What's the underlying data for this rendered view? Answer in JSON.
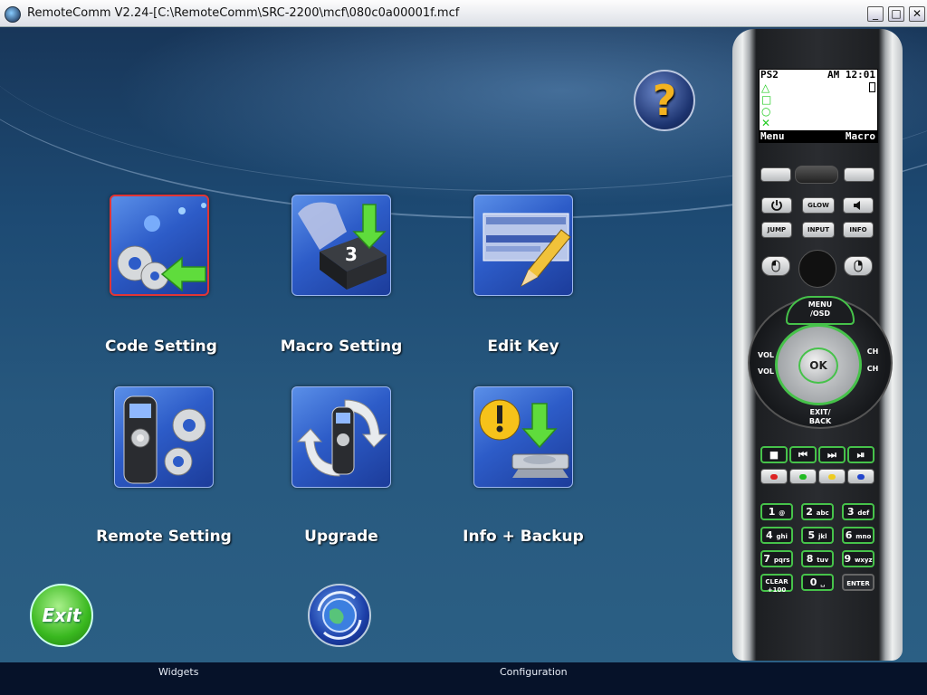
{
  "window": {
    "title": "RemoteComm V2.24-[C:\\RemoteComm\\SRC-2200\\mcf\\080c0a00001f.mcf",
    "minimize": "_",
    "maximize": "□",
    "close": "✕"
  },
  "main": {
    "help_symbol": "?",
    "tiles": [
      {
        "label": "Code Setting",
        "selected": true
      },
      {
        "label": "Macro Setting",
        "selected": false
      },
      {
        "label": "Edit Key",
        "selected": false
      },
      {
        "label": "Remote Setting",
        "selected": false
      },
      {
        "label": "Upgrade",
        "selected": false
      },
      {
        "label": "Info + Backup",
        "selected": false
      }
    ],
    "exit_label": "Exit"
  },
  "bottom_tabs": [
    "Widgets",
    "Configuration"
  ],
  "remote": {
    "lcd": {
      "device": "PS2",
      "time": "AM 12:01",
      "symbols": [
        "△",
        "□",
        "○",
        "✕"
      ],
      "soft_left": "Menu",
      "soft_right": "Macro"
    },
    "top_buttons": [
      "GLOW",
      "JUMP",
      "INPUT",
      "INFO"
    ],
    "nav": {
      "menu": "MENU",
      "osd": "/OSD",
      "vol": "VOL",
      "ch": "CH",
      "ok": "OK",
      "exit": "EXIT/",
      "back": "BACK"
    },
    "keypad": [
      {
        "num": "1",
        "sub": "@"
      },
      {
        "num": "2",
        "sub": "abc"
      },
      {
        "num": "3",
        "sub": "def"
      },
      {
        "num": "4",
        "sub": "ghi"
      },
      {
        "num": "5",
        "sub": "jkl"
      },
      {
        "num": "6",
        "sub": "mno"
      },
      {
        "num": "7",
        "sub": "pqrs"
      },
      {
        "num": "8",
        "sub": "tuv"
      },
      {
        "num": "9",
        "sub": "wxyz"
      },
      {
        "num": "CLEAR",
        "sub": "+100"
      },
      {
        "num": "0",
        "sub": "␣"
      },
      {
        "num": "ENTER",
        "sub": ""
      }
    ]
  },
  "colors": {
    "accent_green": "#46c24a",
    "selected_border": "#e23535",
    "help_question": "#f3b320"
  }
}
